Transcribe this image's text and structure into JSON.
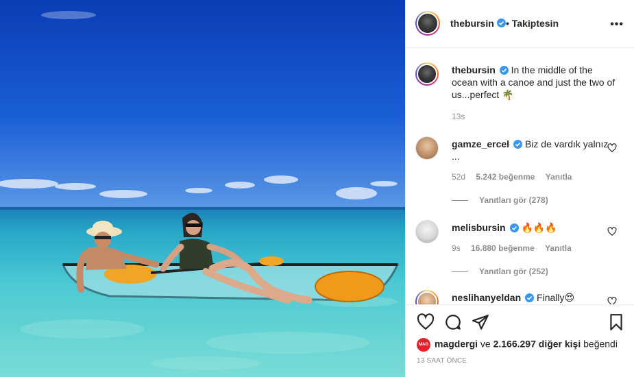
{
  "post": {
    "author": "thebursin",
    "follow_status": "• Takiptesin",
    "more_label": "•••",
    "caption": "In the middle of the ocean with a canoe and just the two of us...perfect 🌴",
    "caption_time": "13s"
  },
  "comments": [
    {
      "username": "gamze_ercel",
      "text": "Biz de vardık yalnız ...",
      "time": "52d",
      "likes": "5.242 beğenme",
      "reply_label": "Yanıtla",
      "view_replies": "Yanıtları gör (278)"
    },
    {
      "username": "melisbursin",
      "text": "🔥🔥🔥",
      "time": "9s",
      "likes": "16.880 beğenme",
      "reply_label": "Yanıtla",
      "view_replies": "Yanıtları gör (252)"
    },
    {
      "username": "neslihanyeldan",
      "text": "Finally😍"
    }
  ],
  "likes": {
    "liker": "magdergi",
    "liker_badge": "MAG",
    "connector": "ve",
    "count_text": "2.166.297 diğer kişi",
    "suffix": "beğendi"
  },
  "timestamp": "13 SAAT ÖNCE",
  "colors": {
    "verified": "#3897f0",
    "text": "#262626",
    "muted": "#8e8e8e",
    "sea": "#3fc0d0",
    "sky": "#1456cf"
  },
  "icons": [
    "heart-icon",
    "comment-icon",
    "share-icon",
    "bookmark-icon",
    "verified-icon",
    "more-icon"
  ]
}
